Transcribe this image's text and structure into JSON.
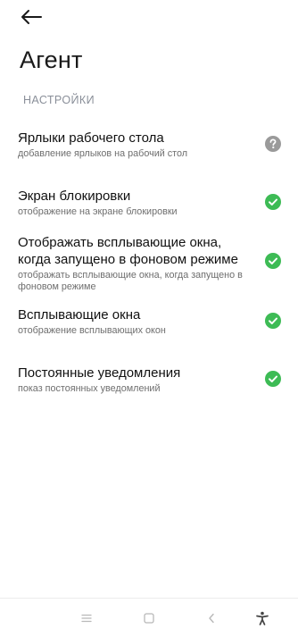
{
  "header": {
    "back_icon": "arrow-left-icon",
    "title": "Агент"
  },
  "section": {
    "label": "НАСТРОЙКИ"
  },
  "settings": [
    {
      "title": "Ярлыки рабочего стола",
      "description": "добавление ярлыков на рабочий стол",
      "status": "unknown",
      "status_icon": "question-circle-icon"
    },
    {
      "title": "Экран блокировки",
      "description": "отображение на экране блокировки",
      "status": "enabled",
      "status_icon": "check-circle-icon"
    },
    {
      "title": "Отображать всплывающие окна, когда запущено в фоновом режиме",
      "description": "отображать всплывающие окна, когда запущено в фоновом режиме",
      "status": "enabled",
      "status_icon": "check-circle-icon"
    },
    {
      "title": "Всплывающие окна",
      "description": "отображение всплывающих окон",
      "status": "enabled",
      "status_icon": "check-circle-icon"
    },
    {
      "title": "Постоянные уведомления",
      "description": "показ постоянных уведомлений",
      "status": "enabled",
      "status_icon": "check-circle-icon"
    }
  ],
  "nav_bar": {
    "icons": [
      "menu-icon",
      "home-square-icon",
      "back-chevron-icon",
      "accessibility-icon"
    ]
  },
  "colors": {
    "enabled": "#3dbb55",
    "unknown": "#9a9a9a",
    "section": "#8a8f99",
    "nav_icon": "#b8b8b8"
  }
}
